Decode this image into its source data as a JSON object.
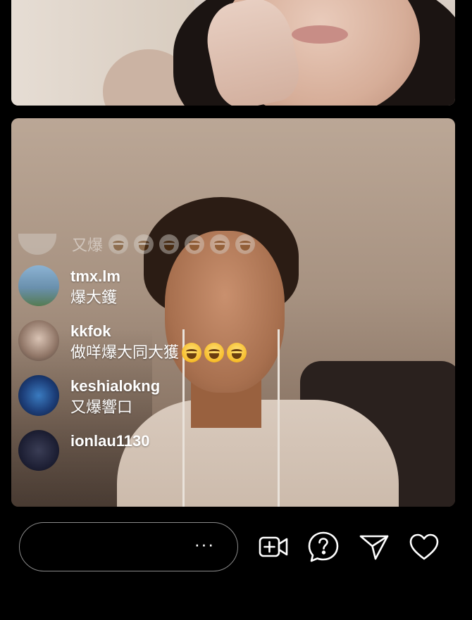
{
  "faded_comment": {
    "text": "又爆"
  },
  "comments": [
    {
      "username": "tmx.lm",
      "message": "爆大鑊",
      "emoji_count": 0
    },
    {
      "username": "kkfok",
      "message": "做咩爆大同大獲",
      "emoji_count": 3
    },
    {
      "username": "keshialokng",
      "message": "又爆響口",
      "emoji_count": 0
    },
    {
      "username": "ionlau1130",
      "message": "",
      "emoji_count": 0
    }
  ],
  "input": {
    "placeholder": "",
    "more_label": "···"
  },
  "icons": {
    "add_guest": "video-plus-icon",
    "question": "question-icon",
    "share": "send-icon",
    "like": "heart-icon"
  },
  "colors": {
    "background": "#000000",
    "text": "#ffffff",
    "input_border": "#8a8a8a"
  }
}
